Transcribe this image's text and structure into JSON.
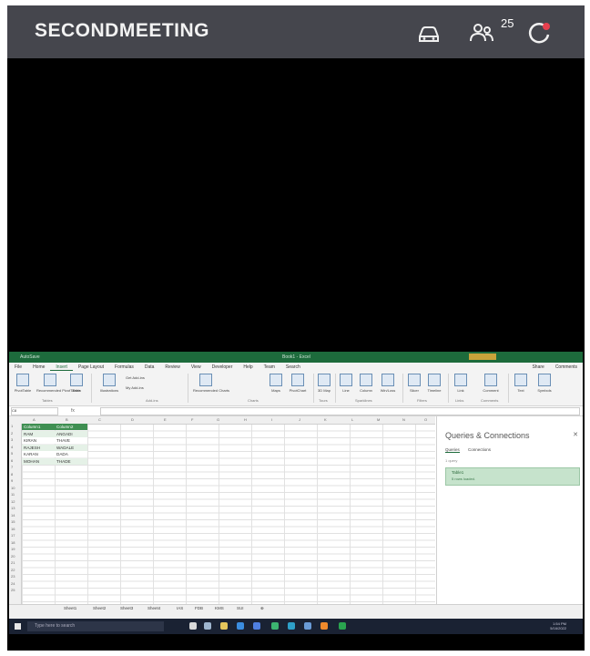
{
  "header": {
    "title": "SECONDMEETING",
    "participant_count": "25",
    "icons": [
      "car-icon",
      "participants-icon",
      "refresh-icon"
    ],
    "colors": {
      "bar": "#45464d",
      "title": "#f2f2f2",
      "alert_dot": "#e6404f"
    }
  },
  "excel": {
    "window_title": "Book1 - Excel",
    "menu": [
      "File",
      "Home",
      "Insert",
      "Page Layout",
      "Formulas",
      "Data",
      "Review",
      "View",
      "Developer",
      "Help",
      "Team",
      "Search"
    ],
    "menu_right": [
      "Share",
      "Comments"
    ],
    "ribbon_buttons": [
      "PivotTable",
      "Recommended PivotTables",
      "Table",
      "Illustrations",
      "Get Add-ins",
      "My Add-ins",
      "Recommended Charts",
      "Maps",
      "PivotChart",
      "3D Map",
      "Line",
      "Column",
      "Win/Loss",
      "Slicer",
      "Timeline",
      "Link",
      "Comment",
      "Text",
      "Symbols"
    ],
    "ribbon_groups": [
      "Tables",
      "Add-ins",
      "Charts",
      "Tours",
      "Sparklines",
      "Filters",
      "Links",
      "Comments"
    ],
    "name_box": "C8",
    "fx": "fx",
    "columns": [
      "A",
      "B",
      "C",
      "D",
      "E",
      "F",
      "G",
      "H",
      "I",
      "J",
      "K",
      "L",
      "M",
      "N",
      "O"
    ],
    "rows": [
      "1",
      "2",
      "3",
      "4",
      "5",
      "6",
      "7",
      "8",
      "9",
      "10",
      "11",
      "12",
      "13",
      "14",
      "15",
      "16",
      "17",
      "18",
      "19",
      "20",
      "21",
      "22",
      "23",
      "24",
      "25"
    ],
    "table": {
      "headers": [
        "Column1",
        "Column2"
      ],
      "rows": [
        [
          "RAM",
          "ANGADI"
        ],
        [
          "KIRAN",
          "THAVE"
        ],
        [
          "RAJESH",
          "WADALE"
        ],
        [
          "KARAN",
          "DADA"
        ],
        [
          "MOHAN",
          "THADE"
        ]
      ]
    },
    "queries_pane": {
      "title": "Queries & Connections",
      "tabs": [
        "Queries",
        "Connections"
      ],
      "count": "1 query",
      "item_name": "Table1",
      "item_status": "5 rows loaded."
    },
    "sheet_tabs": [
      "Sheet1",
      "Sheet2",
      "Sheet3",
      "Sheet4",
      "IAS",
      "FDB",
      "KMS",
      "SUI"
    ],
    "taskbar_search": "Type here to search",
    "clock_time": "1:54 PM",
    "clock_date": "5/16/2022"
  }
}
